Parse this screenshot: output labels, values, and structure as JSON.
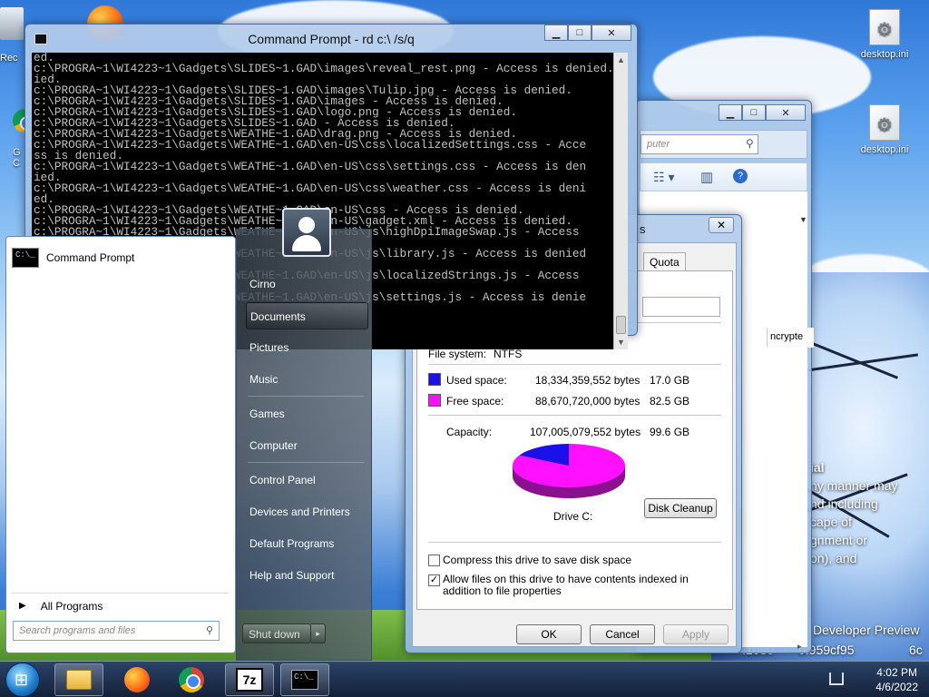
{
  "desktop": {
    "icons": [
      {
        "label": "desktop.ini"
      },
      {
        "label": "desktop.ini"
      }
    ],
    "left_labels": [
      "Rec",
      "G",
      "C"
    ],
    "wallpaper_text": {
      "heading": "ial",
      "lines": [
        "ny manner may",
        "nd including",
        "cape of",
        "gnment or",
        "on), and"
      ],
      "footer1": "Developer Preview",
      "footer2": ".1080",
      "footer3": "0.959cf95",
      "footer4": "6c"
    }
  },
  "cmd": {
    "title": "Command Prompt - rd  c:\\ /s/q",
    "lines": [
      "ed.",
      "c:\\PROGRA~1\\WI4223~1\\Gadgets\\SLIDES~1.GAD\\images\\reveal_rest.png - Access is denied.",
      "ied.",
      "c:\\PROGRA~1\\WI4223~1\\Gadgets\\SLIDES~1.GAD\\images\\Tulip.jpg - Access is denied.",
      "c:\\PROGRA~1\\WI4223~1\\Gadgets\\SLIDES~1.GAD\\images - Access is denied.",
      "c:\\PROGRA~1\\WI4223~1\\Gadgets\\SLIDES~1.GAD\\logo.png - Access is denied.",
      "c:\\PROGRA~1\\WI4223~1\\Gadgets\\SLIDES~1.GAD - Access is denied.",
      "c:\\PROGRA~1\\WI4223~1\\Gadgets\\WEATHE~1.GAD\\drag.png - Access is denied.",
      "c:\\PROGRA~1\\WI4223~1\\Gadgets\\WEATHE~1.GAD\\en-US\\css\\localizedSettings.css - Acce",
      "ss is denied.",
      "c:\\PROGRA~1\\WI4223~1\\Gadgets\\WEATHE~1.GAD\\en-US\\css\\settings.css - Access is den",
      "ied.",
      "c:\\PROGRA~1\\WI4223~1\\Gadgets\\WEATHE~1.GAD\\en-US\\css\\weather.css - Access is deni",
      "ed.",
      "c:\\PROGRA~1\\WI4223~1\\Gadgets\\WEATHE~1.GAD\\en-US\\css - Access is denied.",
      "c:\\PROGRA~1\\WI4223~1\\Gadgets\\WEATHE~1.GAD\\en-US\\gadget.xml - Access is denied.",
      "c:\\PROGRA~1\\WI4223~1\\Gadgets\\WEATHE~1.GAD\\en-US\\js\\highDpiImageSwap.js - Access",
      "",
      "c:\\PROGRA~1\\WI4223~1\\Gadgets\\WEATHE~1.GAD\\en-US\\js\\library.js - Access is denied",
      "",
      "c:\\PROGRA~1\\WI4223~1\\Gadgets\\WEATHE~1.GAD\\en-US\\js\\localizedStrings.js - Access",
      "",
      "c:\\PROGRA~1\\WI4223~1\\Gadgets\\WEATHE~1.GAD\\en-US\\js\\settings.js - Access is denie"
    ]
  },
  "explorer": {
    "search_placeholder": "puter",
    "column_header": "ncrypte"
  },
  "properties": {
    "title": "s",
    "tab_quota": "Quota",
    "file_system_label": "File system:",
    "file_system_value": "NTFS",
    "used_label": "Used space:",
    "used_bytes": "18,334,359,552 bytes",
    "used_gb": "17.0 GB",
    "free_label": "Free space:",
    "free_bytes": "88,670,720,000 bytes",
    "free_gb": "82.5 GB",
    "capacity_label": "Capacity:",
    "capacity_bytes": "107,005,079,552 bytes",
    "capacity_gb": "99.6 GB",
    "drive_label": "Drive C:",
    "disk_cleanup": "Disk Cleanup",
    "compress_label": "Compress this drive to save disk space",
    "index_label": "Allow files on this drive to have contents indexed in addition to file properties",
    "ok": "OK",
    "cancel": "Cancel",
    "apply": "Apply",
    "colors": {
      "used": "#1a10e8",
      "free": "#ff10ff"
    },
    "used_fraction": 0.171
  },
  "start_menu": {
    "pinned": "Command Prompt",
    "all_programs": "All Programs",
    "search_placeholder": "Search programs and files",
    "right_items": [
      "Cirno",
      "Documents",
      "Pictures",
      "Music",
      "Games",
      "Computer",
      "Control Panel",
      "Devices and Printers",
      "Default Programs",
      "Help and Support"
    ],
    "shutdown": "Shut down"
  },
  "taskbar": {
    "time": "4:02 PM",
    "date": "4/6/2022",
    "apps": [
      "explorer-icon",
      "firefox-icon",
      "chrome-icon",
      "7zip-icon",
      "cmd-icon"
    ]
  }
}
